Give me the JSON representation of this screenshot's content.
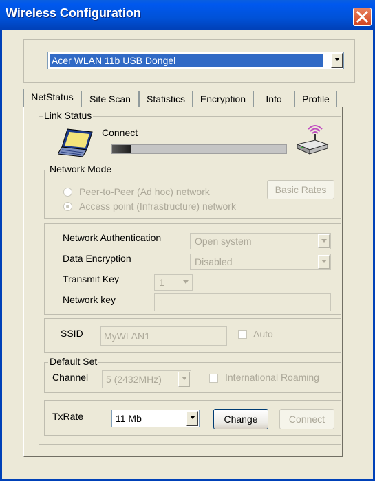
{
  "window": {
    "title": "Wireless Configuration"
  },
  "device": {
    "selected": "Acer WLAN 11b USB Dongel"
  },
  "tabs": [
    {
      "label": "NetStatus",
      "active": true
    },
    {
      "label": "Site Scan",
      "active": false
    },
    {
      "label": "Statistics",
      "active": false
    },
    {
      "label": "Encryption",
      "active": false
    },
    {
      "label": "Info",
      "active": false
    },
    {
      "label": "Profile",
      "active": false
    }
  ],
  "link_status": {
    "legend": "Link Status",
    "status": "Connect",
    "signal_fraction": 0.11,
    "icons": [
      "laptop-icon",
      "access-point-icon"
    ]
  },
  "network_mode": {
    "legend": "Network Mode",
    "option_adhoc": "Peer-to-Peer (Ad hoc) network",
    "option_infra": "Access point (Infrastructure) network",
    "selected": "infrastructure",
    "basic_rates": "Basic Rates"
  },
  "security": {
    "auth_label": "Network Authentication",
    "auth_value": "Open system",
    "enc_label": "Data Encryption",
    "enc_value": "Disabled",
    "tx_key_label": "Transmit Key",
    "tx_key_value": "1",
    "net_key_label": "Network key",
    "net_key_value": ""
  },
  "ssid": {
    "label": "SSID",
    "value": "MyWLAN1",
    "auto_label": "Auto",
    "auto_checked": false
  },
  "default_set": {
    "legend": "Default Set",
    "channel_label": "Channel",
    "channel_value": "5  (2432MHz)",
    "roaming_label": "International Roaming",
    "roaming_checked": false
  },
  "txrate": {
    "label": "TxRate",
    "value": "11 Mb",
    "change": "Change",
    "connect": "Connect"
  }
}
